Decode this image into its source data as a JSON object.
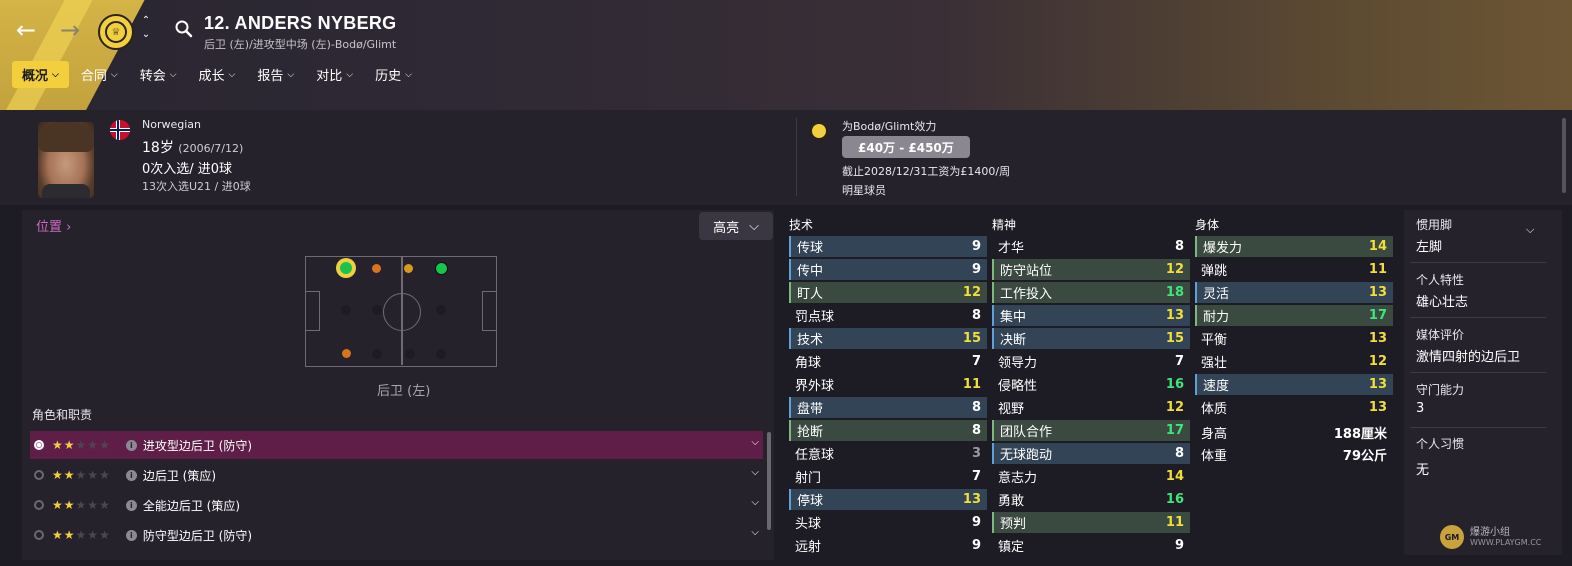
{
  "header": {
    "player_title": "12. ANDERS NYBERG",
    "subtitle": "后卫 (左)/进攻型中场 (左)-Bodø/Glimt",
    "tabs": [
      {
        "label": "概况"
      },
      {
        "label": "合同"
      },
      {
        "label": "转会"
      },
      {
        "label": "成长"
      },
      {
        "label": "报告"
      },
      {
        "label": "对比"
      },
      {
        "label": "历史"
      }
    ],
    "active_tab": "概况"
  },
  "info": {
    "nationality": "Norwegian",
    "age": "18岁",
    "dob": "(2006/7/12)",
    "caps": "0次入选/ 进0球",
    "u21": "13次入选U21 / 进0球",
    "plays_for": "为Bodø/Glimt效力",
    "value": "£40万 - £450万",
    "contract": "截止2028/12/31工资为£1400/周",
    "status": "明星球员"
  },
  "position": {
    "link_label": "位置",
    "highlight_label": "高亮",
    "pitch_label": "后卫 (左)",
    "roles_title": "角色和职责",
    "roles": [
      {
        "name": "进攻型边后卫 (防守)",
        "stars": 2
      },
      {
        "name": "边后卫 (策应)",
        "stars": 2
      },
      {
        "name": "全能边后卫 (策应)",
        "stars": 2
      },
      {
        "name": "防守型边后卫 (防守)",
        "stars": 2
      }
    ]
  },
  "attributes": {
    "technical_title": "技术",
    "mental_title": "精神",
    "physical_title": "身体",
    "technical": [
      {
        "name": "传球",
        "value": "9"
      },
      {
        "name": "传中",
        "value": "9"
      },
      {
        "name": "盯人",
        "value": "12"
      },
      {
        "name": "罚点球",
        "value": "8"
      },
      {
        "name": "技术",
        "value": "15"
      },
      {
        "name": "角球",
        "value": "7"
      },
      {
        "name": "界外球",
        "value": "11"
      },
      {
        "name": "盘带",
        "value": "8"
      },
      {
        "name": "抢断",
        "value": "8"
      },
      {
        "name": "任意球",
        "value": "3"
      },
      {
        "name": "射门",
        "value": "7"
      },
      {
        "name": "停球",
        "value": "13"
      },
      {
        "name": "头球",
        "value": "9"
      },
      {
        "name": "远射",
        "value": "9"
      }
    ],
    "mental": [
      {
        "name": "才华",
        "value": "8"
      },
      {
        "name": "防守站位",
        "value": "12"
      },
      {
        "name": "工作投入",
        "value": "18"
      },
      {
        "name": "集中",
        "value": "13"
      },
      {
        "name": "决断",
        "value": "15"
      },
      {
        "name": "领导力",
        "value": "7"
      },
      {
        "name": "侵略性",
        "value": "16"
      },
      {
        "name": "视野",
        "value": "12"
      },
      {
        "name": "团队合作",
        "value": "17"
      },
      {
        "name": "无球跑动",
        "value": "8"
      },
      {
        "name": "意志力",
        "value": "14"
      },
      {
        "name": "勇敢",
        "value": "16"
      },
      {
        "name": "预判",
        "value": "11"
      },
      {
        "name": "镇定",
        "value": "9"
      }
    ],
    "physical": [
      {
        "name": "爆发力",
        "value": "14"
      },
      {
        "name": "弹跳",
        "value": "11"
      },
      {
        "name": "灵活",
        "value": "13"
      },
      {
        "name": "耐力",
        "value": "17"
      },
      {
        "name": "平衡",
        "value": "13"
      },
      {
        "name": "强壮",
        "value": "12"
      },
      {
        "name": "速度",
        "value": "13"
      },
      {
        "name": "体质",
        "value": "13"
      }
    ],
    "height_label": "身高",
    "height_value": "188厘米",
    "weight_label": "体重",
    "weight_value": "79公斤"
  },
  "side": {
    "foot_label": "惯用脚",
    "foot_value": "左脚",
    "traits_label": "个人特性",
    "traits_value": "雄心壮志",
    "media_label": "媒体评价",
    "media_value": "激情四射的边后卫",
    "gk_label": "守门能力",
    "gk_value": "3",
    "habits_label": "个人习惯",
    "habits_value": "无"
  },
  "watermark": {
    "text": "爆游小组",
    "url": "WWW.PLAYGM.CC"
  },
  "colors": {
    "accent": "#f4cf3d",
    "role_active": "#5e1e48",
    "highlight_blue": "#334457",
    "highlight_green": "#3b4a40",
    "attr_green": "#3ee67a",
    "attr_yellow": "#f1de3a"
  }
}
